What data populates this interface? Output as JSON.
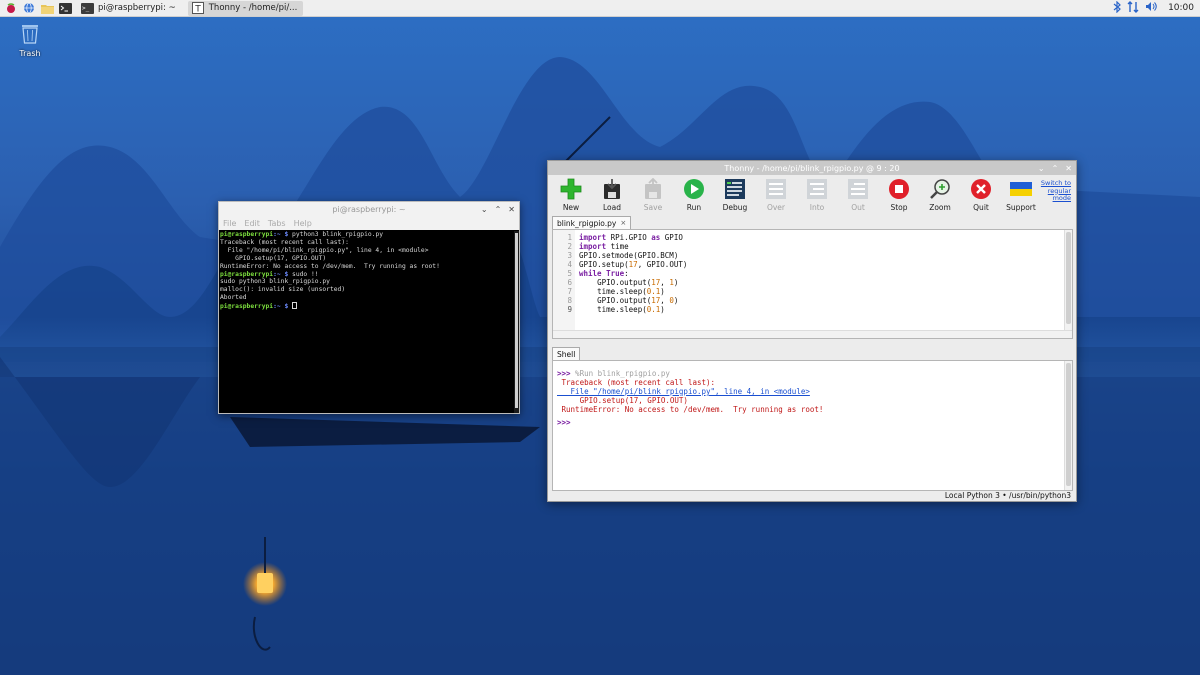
{
  "taskbar": {
    "tasks": [
      {
        "label": "pi@raspberrypi: ~",
        "icon": "terminal-icon"
      },
      {
        "label": "Thonny  -  /home/pi/...",
        "icon": "thonny-icon"
      }
    ],
    "clock": "10:00"
  },
  "desktop": {
    "trash_label": "Trash"
  },
  "terminal": {
    "title": "pi@raspberrypi: ~",
    "menu": [
      "File",
      "Edit",
      "Tabs",
      "Help"
    ],
    "prompt_user": "pi@raspberrypi",
    "prompt_path": ":~ $",
    "lines": [
      {
        "type": "prompt",
        "cmd": " python3 blink_rpigpio.py"
      },
      {
        "type": "out",
        "text": "Traceback (most recent call last):"
      },
      {
        "type": "out",
        "text": "  File \"/home/pi/blink_rpigpio.py\", line 4, in <module>"
      },
      {
        "type": "out",
        "text": "    GPIO.setup(17, GPIO.OUT)"
      },
      {
        "type": "out",
        "text": "RuntimeError: No access to /dev/mem.  Try running as root!"
      },
      {
        "type": "prompt",
        "cmd": " sudo !!"
      },
      {
        "type": "out",
        "text": "sudo python3 blink_rpigpio.py"
      },
      {
        "type": "out",
        "text": "malloc(): invalid size (unsorted)"
      },
      {
        "type": "out",
        "text": "Aborted"
      },
      {
        "type": "prompt",
        "cmd": " "
      }
    ]
  },
  "thonny": {
    "title": "Thonny  -  /home/pi/blink_rpigpio.py  @  9 : 20",
    "toolbar": [
      {
        "label": "New",
        "icon": "new-file-icon",
        "enabled": true
      },
      {
        "label": "Load",
        "icon": "load-icon",
        "enabled": true
      },
      {
        "label": "Save",
        "icon": "save-icon",
        "enabled": false
      },
      {
        "label": "Run",
        "icon": "run-icon",
        "enabled": true
      },
      {
        "label": "Debug",
        "icon": "debug-icon",
        "enabled": true
      },
      {
        "label": "Over",
        "icon": "step-over-icon",
        "enabled": false
      },
      {
        "label": "Into",
        "icon": "step-into-icon",
        "enabled": false
      },
      {
        "label": "Out",
        "icon": "step-out-icon",
        "enabled": false
      },
      {
        "label": "Stop",
        "icon": "stop-icon",
        "enabled": true
      },
      {
        "label": "Zoom",
        "icon": "zoom-icon",
        "enabled": true
      },
      {
        "label": "Quit",
        "icon": "quit-icon",
        "enabled": true
      },
      {
        "label": "Support",
        "icon": "ukraine-flag-icon",
        "enabled": true
      }
    ],
    "switch_mode_label": "Switch to regular mode",
    "editor_tab": "blink_rpigpio.py",
    "editor_tab_close": "×",
    "line_numbers": [
      "1",
      "2",
      "3",
      "4",
      "5",
      "6",
      "7",
      "8",
      "9"
    ],
    "code_lines": [
      "import RPi.GPIO as GPIO",
      "import time",
      "GPIO.setmode(GPIO.BCM)",
      "GPIO.setup(17, GPIO.OUT)",
      "while True:",
      "    GPIO.output(17, 1)",
      "    time.sleep(0.1)",
      "    GPIO.output(17, 0)",
      "    time.sleep(0.1)"
    ],
    "shell_tab": "Shell",
    "shell": {
      "prompt": ">>>",
      "run_cmd": " %Run blink_rpigpio.py",
      "traceback": " Traceback (most recent call last):",
      "file_line": "   File \"/home/pi/blink_rpigpio.py\", line 4, in <module>",
      "code_line": "     GPIO.setup(17, GPIO.OUT)",
      "error": " RuntimeError: No access to /dev/mem.  Try running as root!"
    },
    "status": "Local Python 3  •  /usr/bin/python3"
  }
}
